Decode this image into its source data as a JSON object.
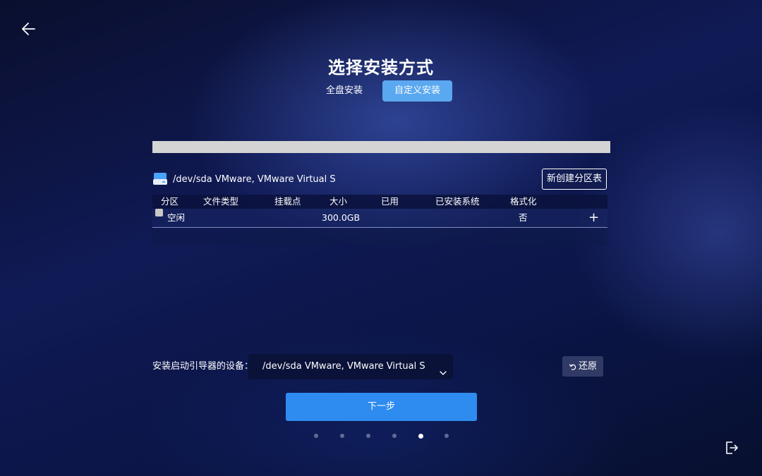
{
  "page": {
    "title": "选择安装方式",
    "tabs": [
      {
        "label": "全盘安装",
        "active": false
      },
      {
        "label": "自定义安装",
        "active": true
      }
    ]
  },
  "disk": {
    "name": "/dev/sda VMware, VMware Virtual S",
    "icon": "drive-icon",
    "new_table_label": "新创建分区表"
  },
  "partition_table": {
    "columns": [
      "分区",
      "文件类型",
      "挂载点",
      "大小",
      "已用",
      "已安装系统",
      "格式化"
    ],
    "rows": [
      {
        "partition": "空闲",
        "filesystem": "",
        "mount": "",
        "size": "300.0GB",
        "used": "",
        "installed_os": "",
        "format": "否",
        "action": "+"
      }
    ]
  },
  "bootloader": {
    "label": "安装启动引导器的设备：",
    "selected": "/dev/sda VMware, VMware Virtual S",
    "restore_label": "还原"
  },
  "footer": {
    "next_label": "下一步",
    "steps_total": 6,
    "current_step": 5
  },
  "colors": {
    "accent": "#2e8cf0",
    "tab_active": "#5aa8f0",
    "disk_bar": "#d4d4d4"
  }
}
